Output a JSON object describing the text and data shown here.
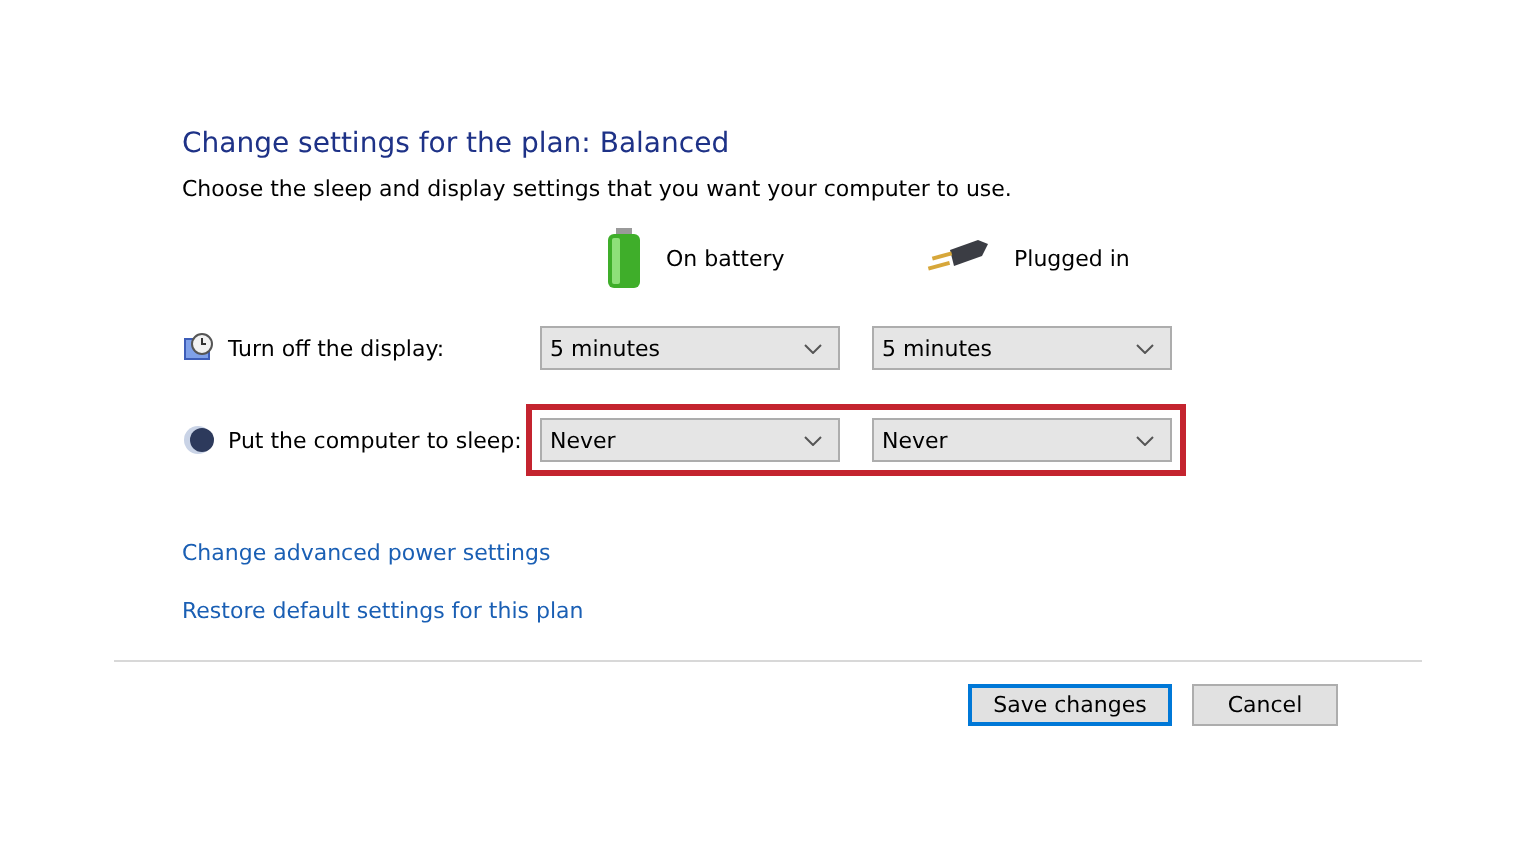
{
  "title": "Change settings for the plan: Balanced",
  "subtitle": "Choose the sleep and display settings that you want your computer to use.",
  "columns": [
    {
      "kind": "battery",
      "label": "On battery"
    },
    {
      "kind": "plug",
      "label": "Plugged in"
    }
  ],
  "settings": [
    {
      "kind": "display",
      "label": "Turn off the display:",
      "values": [
        "5 minutes",
        "5 minutes"
      ],
      "highlighted": false
    },
    {
      "kind": "sleep",
      "label": "Put the computer to sleep:",
      "values": [
        "Never",
        "Never"
      ],
      "highlighted": true
    }
  ],
  "links": [
    "Change advanced power settings",
    "Restore default settings for this plan"
  ],
  "buttons": [
    {
      "label": "Save changes",
      "selected": true
    },
    {
      "label": "Cancel",
      "selected": false
    }
  ]
}
